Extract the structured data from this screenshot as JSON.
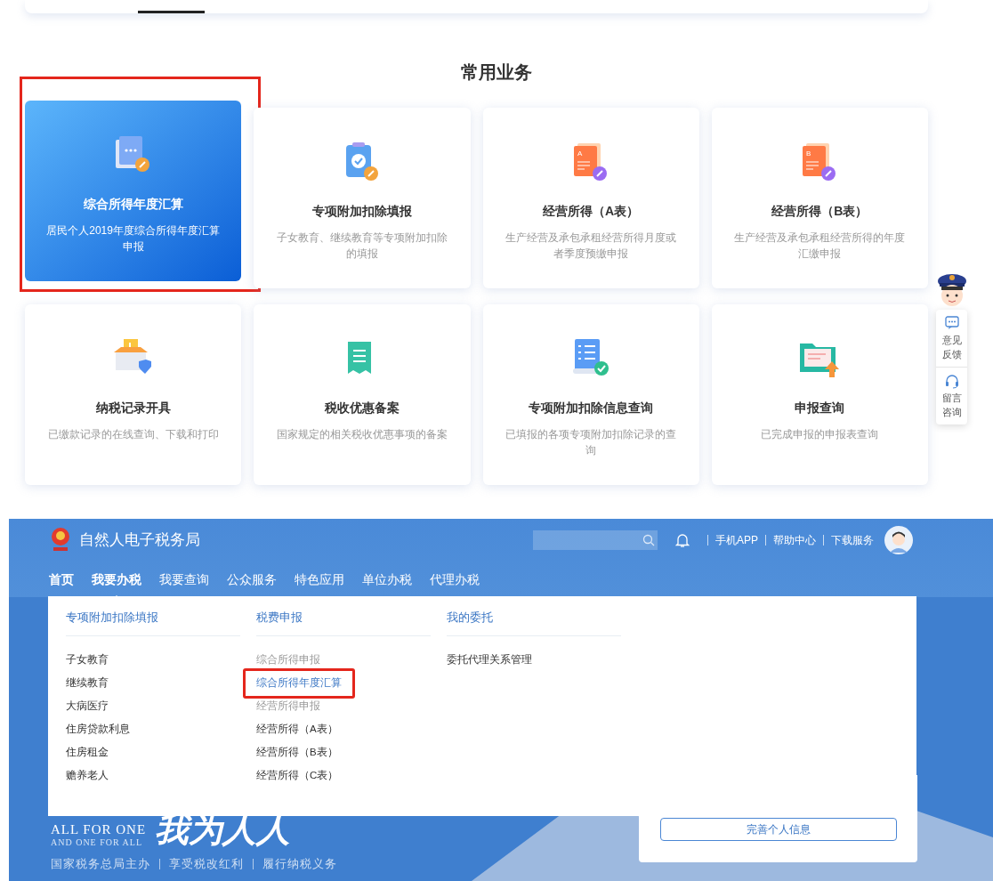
{
  "top_section": {
    "title": "常用业务",
    "cards": [
      {
        "title": "综合所得年度汇算",
        "desc": "居民个人2019年度综合所得年度汇算申报",
        "selected": true,
        "highlighted": true
      },
      {
        "title": "专项附加扣除填报",
        "desc": "子女教育、继续教育等专项附加扣除的填报",
        "selected": false,
        "highlighted": false
      },
      {
        "icon_letter": "A",
        "title": "经营所得（A表）",
        "desc": "生产经营及承包承租经营所得月度或者季度预缴申报",
        "selected": false,
        "highlighted": false
      },
      {
        "icon_letter": "B",
        "title": "经营所得（B表）",
        "desc": "生产经营及承包承租经营所得的年度汇缴申报",
        "selected": false,
        "highlighted": false
      },
      {
        "title": "纳税记录开具",
        "desc": "已缴款记录的在线查询、下载和打印",
        "selected": false,
        "highlighted": false
      },
      {
        "title": "税收优惠备案",
        "desc": "国家规定的相关税收优惠事项的备案",
        "selected": false,
        "highlighted": false
      },
      {
        "title": "专项附加扣除信息查询",
        "desc": "已填报的各项专项附加扣除记录的查询",
        "selected": false,
        "highlighted": false
      },
      {
        "title": "申报查询",
        "desc": "已完成申报的申报表查询",
        "selected": false,
        "highlighted": false
      }
    ]
  },
  "side_widget": {
    "items": [
      {
        "label": "意见反馈"
      },
      {
        "label": "留言咨询"
      }
    ]
  },
  "header": {
    "title": "自然人电子税务局",
    "links": [
      "手机APP",
      "帮助中心",
      "下载服务"
    ]
  },
  "nav": [
    {
      "label": "首页",
      "active": true,
      "expanded": false
    },
    {
      "label": "我要办税",
      "active": false,
      "expanded": true
    },
    {
      "label": "我要查询",
      "active": false,
      "expanded": false
    },
    {
      "label": "公众服务",
      "active": false,
      "expanded": false
    },
    {
      "label": "特色应用",
      "active": false,
      "expanded": false
    },
    {
      "label": "单位办税",
      "active": false,
      "expanded": false
    },
    {
      "label": "代理办税",
      "active": false,
      "expanded": false
    }
  ],
  "dropdown": {
    "columns": [
      {
        "heading": "专项附加扣除填报",
        "items": [
          {
            "label": "子女教育",
            "kind": "link",
            "highlighted": false
          },
          {
            "label": "继续教育",
            "kind": "link",
            "highlighted": false
          },
          {
            "label": "大病医疗",
            "kind": "link",
            "highlighted": false
          },
          {
            "label": "住房贷款利息",
            "kind": "link",
            "highlighted": false
          },
          {
            "label": "住房租金",
            "kind": "link",
            "highlighted": false
          },
          {
            "label": "赡养老人",
            "kind": "link",
            "highlighted": false
          }
        ]
      },
      {
        "heading": "税费申报",
        "items": [
          {
            "label": "综合所得申报",
            "kind": "group",
            "highlighted": false
          },
          {
            "label": "综合所得年度汇算",
            "kind": "link",
            "highlighted": true
          },
          {
            "label": "经营所得申报",
            "kind": "group",
            "highlighted": false
          },
          {
            "label": "经营所得（A表）",
            "kind": "link",
            "highlighted": false
          },
          {
            "label": "经营所得（B表）",
            "kind": "link",
            "highlighted": false
          },
          {
            "label": "经营所得（C表）",
            "kind": "link",
            "highlighted": false
          }
        ]
      },
      {
        "heading": "我的委托",
        "items": [
          {
            "label": "委托代理关系管理",
            "kind": "link",
            "highlighted": false
          }
        ]
      }
    ]
  },
  "banner": {
    "slogan_en": [
      "ALL FOR ONE",
      "AND ONE FOR ALL"
    ],
    "calligraphy": "我为人人",
    "taglines": [
      "国家税务总局主办",
      "享受税改红利",
      "履行纳税义务"
    ],
    "panel_button": "完善个人信息"
  }
}
